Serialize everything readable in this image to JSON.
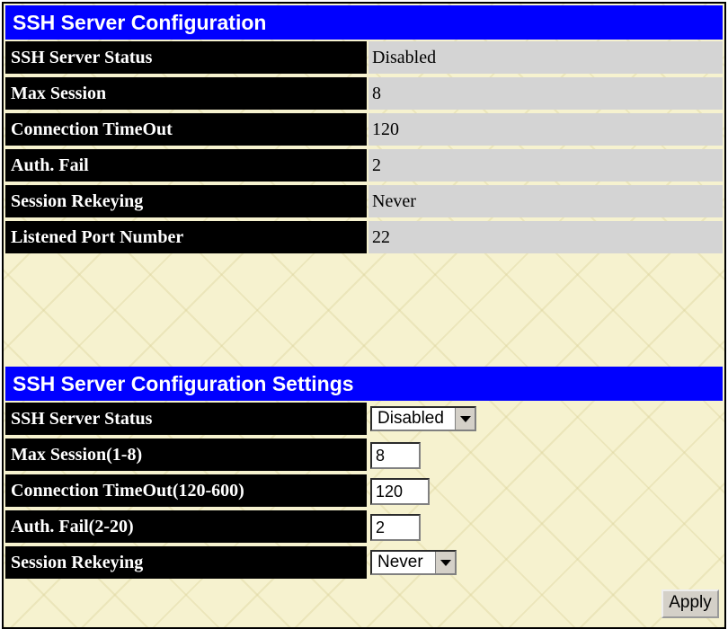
{
  "config": {
    "title": "SSH Server Configuration",
    "rows": [
      {
        "label": "SSH Server Status",
        "value": "Disabled"
      },
      {
        "label": "Max Session",
        "value": "8"
      },
      {
        "label": "Connection TimeOut",
        "value": "120"
      },
      {
        "label": "Auth. Fail",
        "value": "2"
      },
      {
        "label": "Session Rekeying",
        "value": "Never"
      },
      {
        "label": "Listened Port Number",
        "value": "22"
      }
    ]
  },
  "settings": {
    "title": "SSH Server Configuration Settings",
    "server_status": {
      "label": "SSH Server Status",
      "selected": "Disabled"
    },
    "max_session": {
      "label": "Max Session(1-8)",
      "value": "8"
    },
    "timeout": {
      "label": "Connection TimeOut(120-600)",
      "value": "120"
    },
    "auth_fail": {
      "label": "Auth. Fail(2-20)",
      "value": "2"
    },
    "rekeying": {
      "label": "Session Rekeying",
      "selected": "Never"
    },
    "apply_label": "Apply"
  },
  "colors": {
    "header_blue": "#0000ff",
    "label_black": "#000000",
    "value_gray": "#d4d4d4",
    "background_cream": "#f6f2cf"
  }
}
